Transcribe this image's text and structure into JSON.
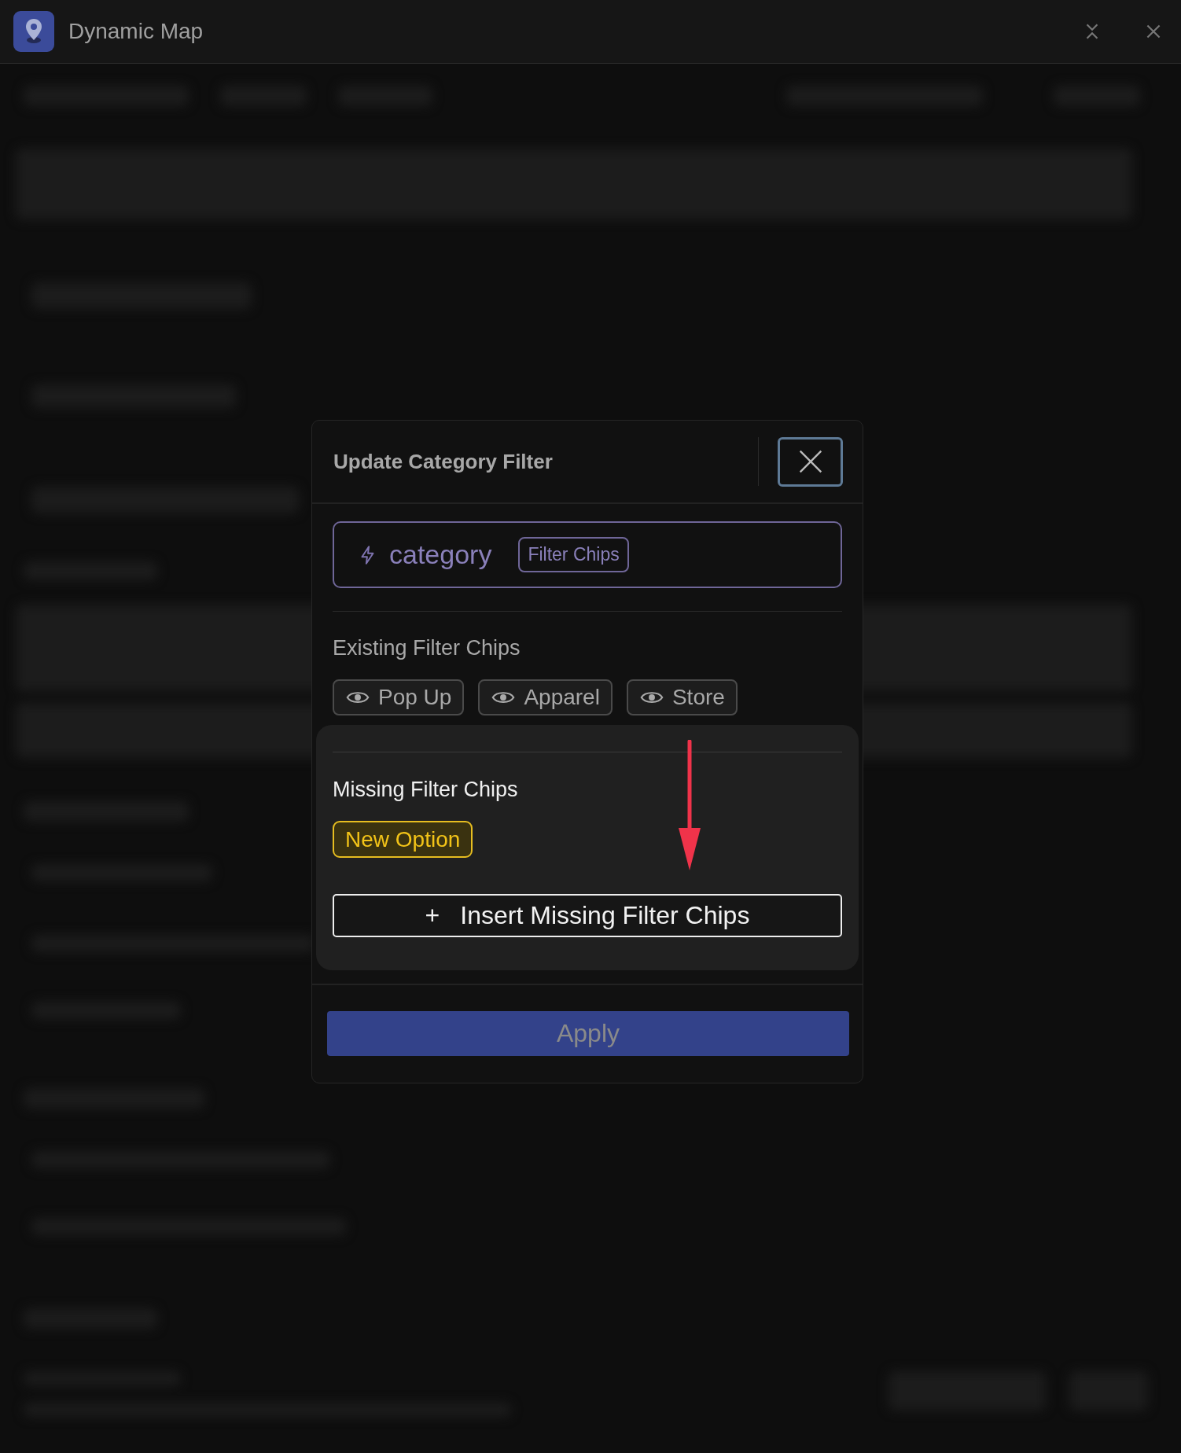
{
  "window": {
    "title": "Dynamic Map"
  },
  "dialog": {
    "title": "Update Category Filter",
    "field": {
      "name": "category",
      "tag": "Filter Chips"
    },
    "existing": {
      "heading": "Existing Filter Chips",
      "chips": [
        {
          "label": "Pop Up"
        },
        {
          "label": "Apparel"
        },
        {
          "label": "Store"
        }
      ]
    },
    "missing": {
      "heading": "Missing Filter Chips",
      "chips": [
        {
          "label": "New Option"
        }
      ],
      "insert_button": "Insert Missing Filter Chips",
      "insert_icon": "+"
    },
    "apply_button": "Apply"
  }
}
